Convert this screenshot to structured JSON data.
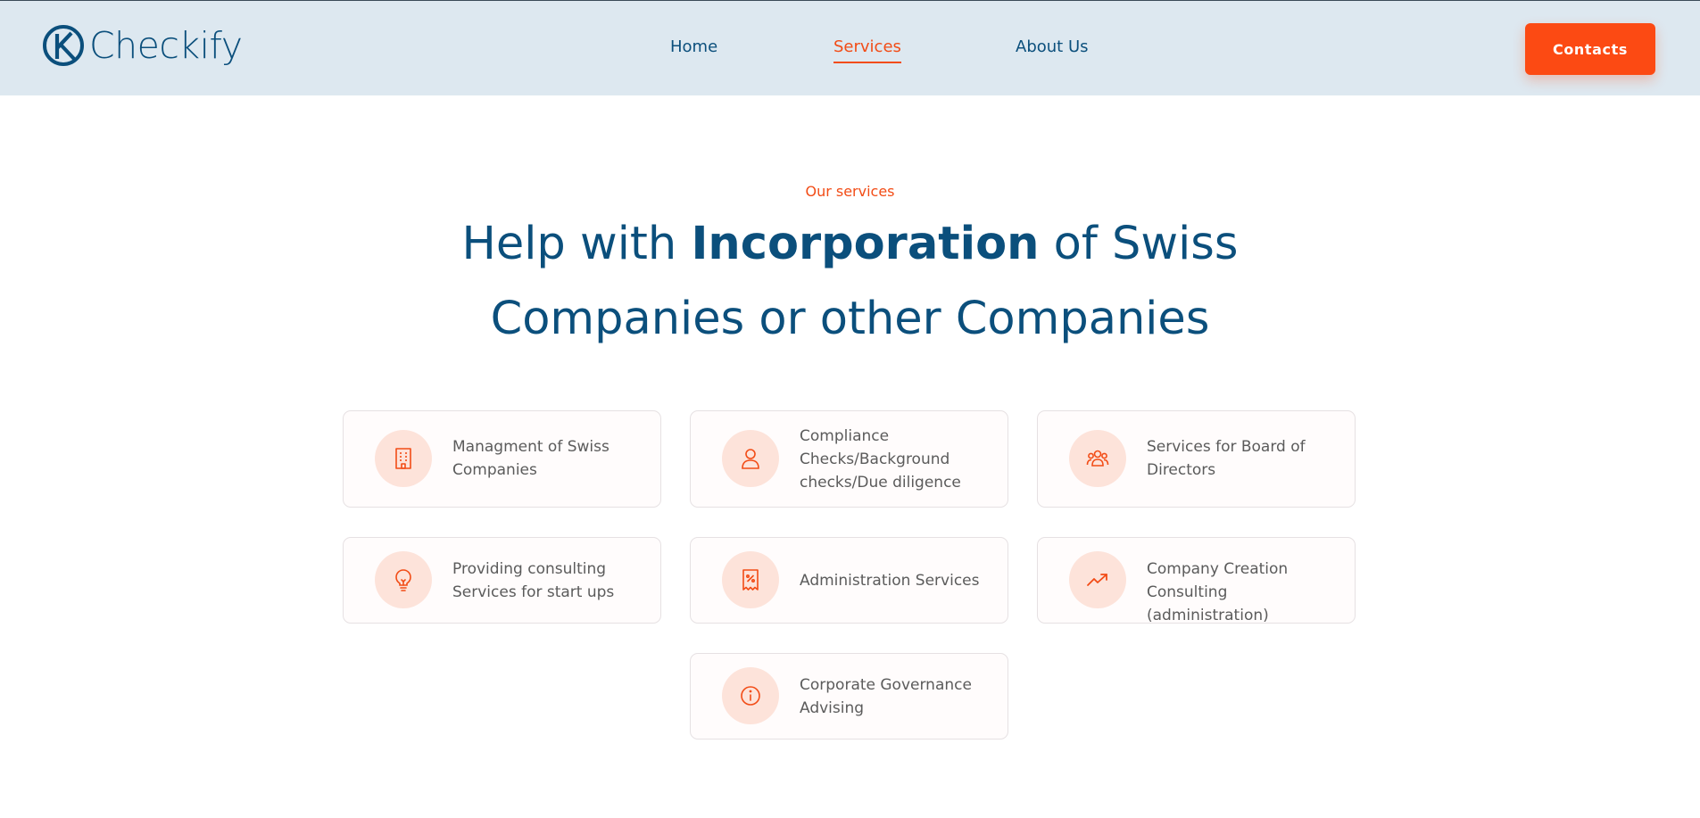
{
  "brand": {
    "name": "Checkify",
    "logo_icon": "k-circle-logo"
  },
  "nav": {
    "home": "Home",
    "services": "Services",
    "about": "About Us"
  },
  "header": {
    "contacts_label": "Contacts"
  },
  "colors": {
    "accent": "#fc4a13",
    "primary": "#0b4f7c",
    "header_bg": "#dde8f0",
    "badge_bg": "#fde3da"
  },
  "hero": {
    "eyebrow": "Our services",
    "title_part1": "Help with ",
    "title_bold": "Incorporation",
    "title_part2": " of Swiss",
    "title_line2": "Companies or other Companies"
  },
  "services": [
    {
      "icon": "building-icon",
      "label": "Managment of Swiss Companies"
    },
    {
      "icon": "user-icon",
      "label": "Compliance Checks/Background checks/Due diligence"
    },
    {
      "icon": "users-group-icon",
      "label": "Services for Board of Directors"
    },
    {
      "icon": "lightbulb-icon",
      "label": "Providing consulting Services for start ups"
    },
    {
      "icon": "receipt-percent-icon",
      "label": "Administration Services"
    },
    {
      "icon": "trending-up-icon",
      "label": "Company Creation Consulting (administration)"
    },
    {
      "icon": "info-circle-icon",
      "label": "Corporate Governance Advising"
    }
  ]
}
